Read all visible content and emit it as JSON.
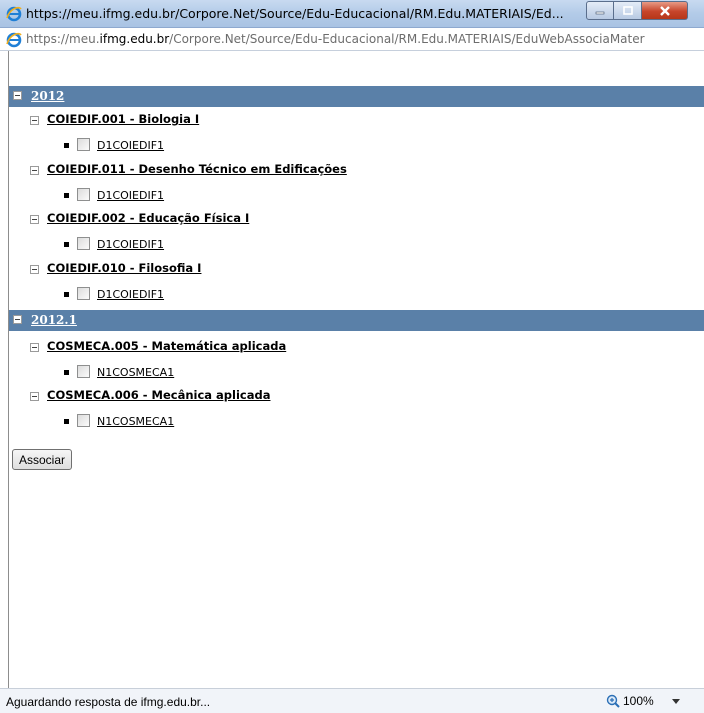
{
  "window": {
    "title": "https://meu.ifmg.edu.br/Corpore.Net/Source/Edu-Educacional/RM.Edu.MATERIAIS/Ed...",
    "url_prefix": "https://meu.",
    "url_domain": "ifmg.edu.br",
    "url_rest": "/Corpore.Net/Source/Edu-Educacional/RM.Edu.MATERIAIS/EduWebAssociaMater"
  },
  "groups": [
    {
      "label": "2012",
      "subjects": [
        {
          "label": "COIEDIF.001 - Biologia I",
          "classes": [
            "D1COIEDIF1"
          ]
        },
        {
          "label": "COIEDIF.011 - Desenho Técnico em Edificações",
          "classes": [
            "D1COIEDIF1"
          ]
        },
        {
          "label": "COIEDIF.002 - Educação Física I",
          "classes": [
            "D1COIEDIF1"
          ]
        },
        {
          "label": "COIEDIF.010 - Filosofia I",
          "classes": [
            "D1COIEDIF1"
          ]
        }
      ]
    },
    {
      "label": "2012.1",
      "subjects": [
        {
          "label": "COSMECA.005 - Matemática aplicada",
          "classes": [
            "N1COSMECA1"
          ]
        },
        {
          "label": "COSMECA.006 - Mecânica aplicada",
          "classes": [
            "N1COSMECA1"
          ]
        }
      ]
    }
  ],
  "buttons": {
    "associar": "Associar"
  },
  "status": {
    "text": "Aguardando resposta de ifmg.edu.br...",
    "zoom": "100%"
  },
  "colors": {
    "group_bar": "#5a80a8",
    "title_bar": "#b3cbe8",
    "close_button": "#c7452b"
  }
}
